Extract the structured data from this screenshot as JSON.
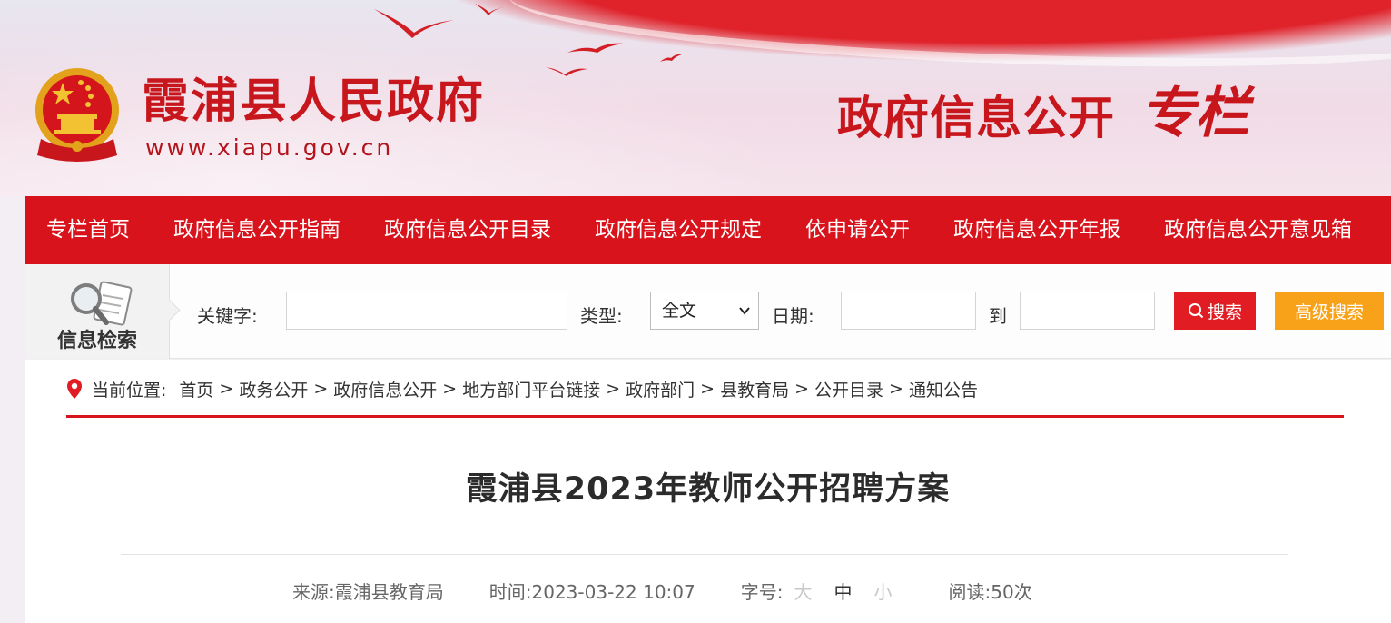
{
  "header": {
    "site_name": "霞浦县人民政府",
    "site_url": "www.xiapu.gov.cn",
    "column_title": "政府信息公开",
    "column_title_em": "专栏",
    "primary_color": "#d8131b"
  },
  "nav": {
    "items": [
      {
        "label": "专栏首页"
      },
      {
        "label": "政府信息公开指南"
      },
      {
        "label": "政府信息公开目录"
      },
      {
        "label": "政府信息公开规定"
      },
      {
        "label": "依申请公开"
      },
      {
        "label": "政府信息公开年报"
      },
      {
        "label": "政府信息公开意见箱"
      }
    ]
  },
  "search": {
    "badge_label": "信息检索",
    "keyword_label": "关键字:",
    "keyword_value": "",
    "type_label": "类型:",
    "type_selected": "全文",
    "date_label": "日期:",
    "date_from": "",
    "date_to_label": "到",
    "date_to": "",
    "search_button": "搜索",
    "advanced_button": "高级搜索",
    "search_color": "#e21c23",
    "advanced_color": "#f8a21a"
  },
  "breadcrumb": {
    "prefix": "当前位置:",
    "items": [
      "首页",
      "政务公开",
      "政府信息公开",
      "地方部门平台链接",
      "政府部门",
      "县教育局",
      "公开目录",
      "通知公告"
    ],
    "separator": ">"
  },
  "article": {
    "title": "霞浦县2023年教师公开招聘方案",
    "source_label": "来源:",
    "source": "霞浦县教育局",
    "time_label": "时间:",
    "time": "2023-03-22 10:07",
    "font_size_label": "字号:",
    "font_sizes": [
      "大",
      "中",
      "小"
    ],
    "views_label": "阅读:",
    "views": "50次"
  }
}
